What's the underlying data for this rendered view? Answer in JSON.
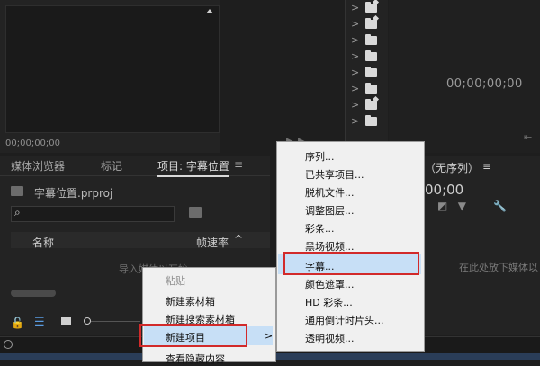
{
  "source_monitor": {
    "timecode": "00;00;00;00"
  },
  "program_monitor": {
    "timecode": "00;00;00;00"
  },
  "project_panel": {
    "tabs": [
      "媒体浏览器",
      "标记",
      "项目: 字幕位置"
    ],
    "menu_glyph": "≡",
    "file_name": "字幕位置.prproj",
    "columns": [
      "名称",
      "帧速率"
    ],
    "sort_glyph": "^",
    "import_hint": "导入媒体以开始"
  },
  "timeline_panel": {
    "title": "（无序列）",
    "menu_glyph": "≡",
    "timecode": "00;00",
    "drop_hint": "在此处放下媒体以"
  },
  "context_menu": {
    "items": [
      {
        "label": "粘贴",
        "enabled": false
      },
      {
        "label": "新建素材箱",
        "enabled": true
      },
      {
        "label": "新建搜索素材箱",
        "enabled": true
      },
      {
        "label": "新建项目",
        "enabled": true,
        "highlighted": true,
        "has_submenu": true
      },
      {
        "label": "查看隐藏内容",
        "enabled": true
      }
    ],
    "submenu_arrow": ">"
  },
  "submenu": {
    "items": [
      "序列...",
      "已共享项目...",
      "脱机文件...",
      "调整图层...",
      "彩条...",
      "黑场视频...",
      "字幕...",
      "颜色遮罩...",
      "HD 彩条...",
      "通用倒计时片头...",
      "透明视频..."
    ],
    "highlighted": "字幕..."
  },
  "annotation_color": "#d22a2a",
  "highlight_color": "#c7dff6"
}
